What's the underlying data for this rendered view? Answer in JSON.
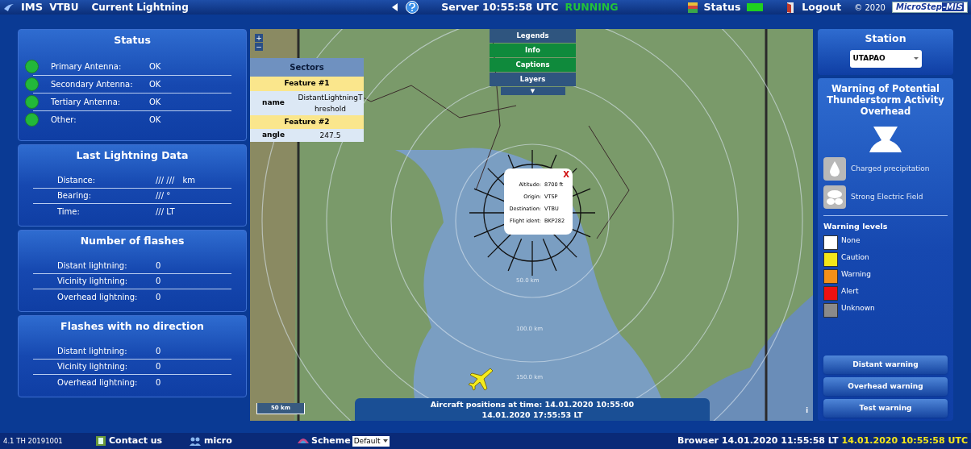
{
  "header": {
    "logo": "IMS",
    "station": "VTBU",
    "title": "Current Lightning",
    "server": "Server 10:55:58 UTC",
    "server_state": "RUNNING",
    "status": "Status",
    "logout": "Logout",
    "copyright": "© 2020",
    "brand": "MicroStep",
    "brand_suffix": "-MIS"
  },
  "panels": [
    {
      "title": "Status",
      "rows": [
        {
          "label": "Primary Antenna:",
          "value": "OK",
          "color": "#22b83a"
        },
        {
          "label": "Secondary Antenna:",
          "value": "OK",
          "color": "#22b83a"
        },
        {
          "label": "Tertiary Antenna:",
          "value": "OK",
          "color": "#22b83a"
        },
        {
          "label": "Other:",
          "value": "OK",
          "color": "#22b83a"
        }
      ]
    },
    {
      "title": "Last Lightning Data",
      "rows": [
        {
          "label": "Distance:",
          "value": "/// ///",
          "unit": "km"
        },
        {
          "label": "Bearing:",
          "value": "/// °"
        },
        {
          "label": "Time:",
          "value": "/// LT"
        }
      ]
    },
    {
      "title": "Number of flashes",
      "rows": [
        {
          "label": "Distant lightning:",
          "value": "0"
        },
        {
          "label": "Vicinity lightning:",
          "value": "0"
        },
        {
          "label": "Overhead lightning:",
          "value": "0"
        }
      ]
    },
    {
      "title": "Flashes with no direction",
      "rows": [
        {
          "label": "Distant lightning:",
          "value": "0"
        },
        {
          "label": "Vicinity lightning:",
          "value": "0"
        },
        {
          "label": "Overhead lightning:",
          "value": "0"
        }
      ]
    }
  ],
  "map": {
    "zoom_in": "+",
    "zoom_out": "−",
    "sectors": {
      "title": "Sectors",
      "features": [
        {
          "heading": "Feature #1",
          "key": "name",
          "value": "DistantLightningThreshold"
        },
        {
          "heading": "Feature #2",
          "key": "angle",
          "value": "247.5"
        }
      ]
    },
    "menu": [
      {
        "label": "Legends",
        "selected": false
      },
      {
        "label": "Info",
        "selected": true
      },
      {
        "label": "Captions",
        "selected": true
      },
      {
        "label": "Layers",
        "selected": false
      }
    ],
    "menu_toggle": "▼",
    "ring_labels": [
      "50.0 km",
      "100.0 km",
      "150.0 km"
    ],
    "popup": {
      "close": "X",
      "rows": [
        {
          "label": "Altitude:",
          "value": "8700 ft"
        },
        {
          "label": "Origin:",
          "value": "VTSP"
        },
        {
          "label": "Destination:",
          "value": "VTBU"
        },
        {
          "label": "Flight ident:",
          "value": "BKP282"
        }
      ]
    },
    "caption": [
      "Aircraft positions at time: 14.01.2020 10:55:00",
      "14.01.2020 17:55:53 LT"
    ],
    "scale": "50 km",
    "info": "i"
  },
  "station": {
    "title": "Station",
    "value": "UTAPAO"
  },
  "warning": {
    "title": "Warning of Potential Thunderstorm Activity Overhead",
    "conditions": [
      {
        "label": "Charged precipitation",
        "kind": "drop",
        "active": false
      },
      {
        "label": "Strong Electric Field",
        "kind": "field",
        "active": false
      }
    ],
    "levels_title": "Warning levels",
    "levels": [
      {
        "label": "None",
        "color": "#ffffff"
      },
      {
        "label": "Caution",
        "color": "#f5e619"
      },
      {
        "label": "Warning",
        "color": "#f39019"
      },
      {
        "label": "Alert",
        "color": "#ee1111"
      },
      {
        "label": "Unknown",
        "color": "#8a8a8a"
      }
    ],
    "buttons": [
      "Distant warning",
      "Overhead warning",
      "Test warning"
    ]
  },
  "footer": {
    "version": "4.1 TH 20191001",
    "contact": "Contact us",
    "user": "micro",
    "scheme_label": "Scheme",
    "scheme_value": "Default",
    "browser_time": "Browser 14.01.2020 11:55:58 LT",
    "utc_time": "14.01.2020 10:55:58 UTC"
  }
}
